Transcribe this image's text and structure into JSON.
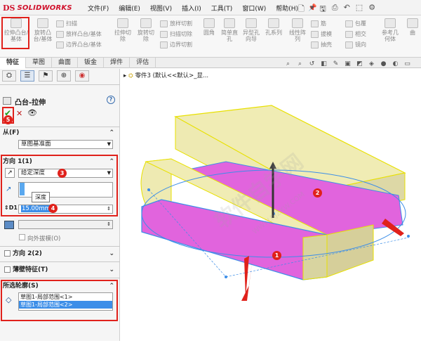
{
  "app": {
    "logo_ds": "DS",
    "logo_text": "SOLIDWORKS"
  },
  "menu": [
    "文件(F)",
    "编辑(E)",
    "视图(V)",
    "插入(I)",
    "工具(T)",
    "窗口(W)",
    "帮助(H)"
  ],
  "ribbon": {
    "extrude_boss": "拉伸凸台/基体",
    "revolve_boss": "旋转凸台/基体",
    "sweep": "扫描",
    "loft": "放样凸台/基体",
    "boundary": "边界凸台/基体",
    "extruded_cut": "拉伸切除",
    "revolved_cut": "旋转切除",
    "lofted_cut": "放样切割",
    "swept_cut": "扫描切除",
    "boundary_cut": "边界切割",
    "fillet": "圆角",
    "rib_simple": "简单直孔",
    "hole_wizard": "异型孔向导",
    "hole_series": "孔系列",
    "linear_pattern": "线性阵列",
    "rib": "筋",
    "draft": "拔模",
    "shell": "抽壳",
    "wrap": "包覆",
    "intersect": "相交",
    "mirror": "镜向",
    "ref_geometry": "参考几何体",
    "curves": "曲"
  },
  "tabs": [
    "特征",
    "草图",
    "曲面",
    "钣金",
    "焊件",
    "评估"
  ],
  "feature_title": "凸台-拉伸",
  "help": "?",
  "from": {
    "label": "从(F)",
    "value": "草图基准面"
  },
  "direction1": {
    "label": "方向 1(1)",
    "end_condition": "给定深度",
    "tooltip": "深度",
    "depth": "15.00mm"
  },
  "draft_outward": "向外拔模(O)",
  "direction2": "方向 2(2)",
  "thin_feature": "薄壁特征(T)",
  "selected_contours": {
    "label": "所选轮廓(S)",
    "items": [
      "草图1-局部范围<1>",
      "草图1-局部范围<2>"
    ]
  },
  "breadcrumb": "零件3 (默认<<默认>_显...",
  "badges": [
    "5",
    "3",
    "4",
    "1",
    "2"
  ],
  "watermark": "软件自学网",
  "watermark_url": "WWW.RJZXW.COM",
  "colors": {
    "accent_red": "#e0211b",
    "face_magenta": "#e164dd",
    "face_yellow": "#f0ecb4",
    "selection_blue": "#3c8ee8"
  }
}
